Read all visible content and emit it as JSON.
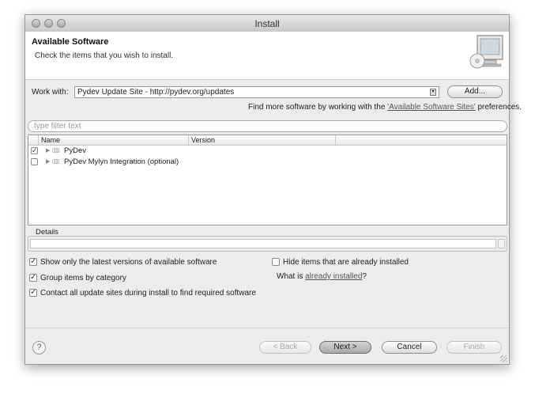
{
  "window": {
    "title": "Install"
  },
  "header": {
    "title": "Available Software",
    "description": "Check the items that you wish to install."
  },
  "work_with": {
    "label": "Work with:",
    "value": "Pydev Update Site - http://pydev.org/updates",
    "add_button": "Add..."
  },
  "find_more": {
    "prefix": "Find more software by working with the ",
    "link": "'Available Software Sites'",
    "suffix": " preferences."
  },
  "filter": {
    "placeholder": "type filter text"
  },
  "table": {
    "columns": [
      "Name",
      "Version"
    ],
    "rows": [
      {
        "name": "PyDev",
        "checked": true
      },
      {
        "name": "PyDev Mylyn Integration (optional)",
        "checked": false
      }
    ]
  },
  "details": {
    "label": "Details"
  },
  "options": {
    "latest_only": {
      "label": "Show only the latest versions of available software",
      "checked": true
    },
    "group_by_category": {
      "label": "Group items by category",
      "checked": true
    },
    "contact_all": {
      "label": "Contact all update sites during install to find required software",
      "checked": true
    },
    "hide_installed": {
      "label": "Hide items that are already installed",
      "checked": false
    },
    "what_is_prefix": "What is ",
    "what_is_link": "already installed",
    "what_is_suffix": "?"
  },
  "buttons": {
    "help": "?",
    "back": "< Back",
    "next": "Next >",
    "cancel": "Cancel",
    "finish": "Finish"
  }
}
